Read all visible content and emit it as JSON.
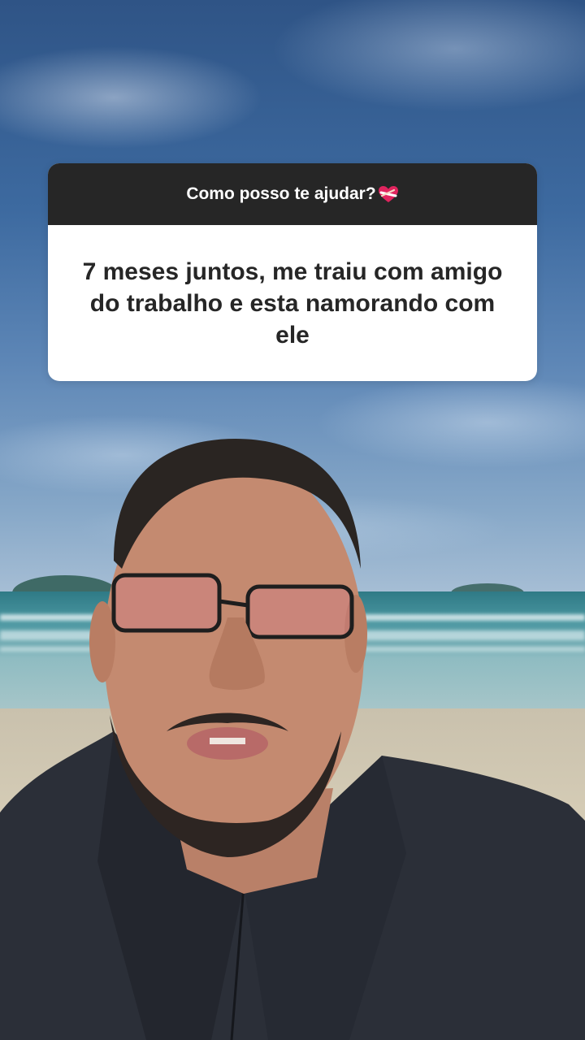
{
  "question_sticker": {
    "prompt": "Como posso te ajudar?",
    "prompt_icon": "mending-heart-icon",
    "answer": "7 meses juntos, me traiu com amigo do trabalho e esta namorando com ele"
  },
  "colors": {
    "sticker_header_bg": "#262626",
    "sticker_body_bg": "#ffffff",
    "sticker_text": "#262626",
    "heart": "#e0245e"
  }
}
